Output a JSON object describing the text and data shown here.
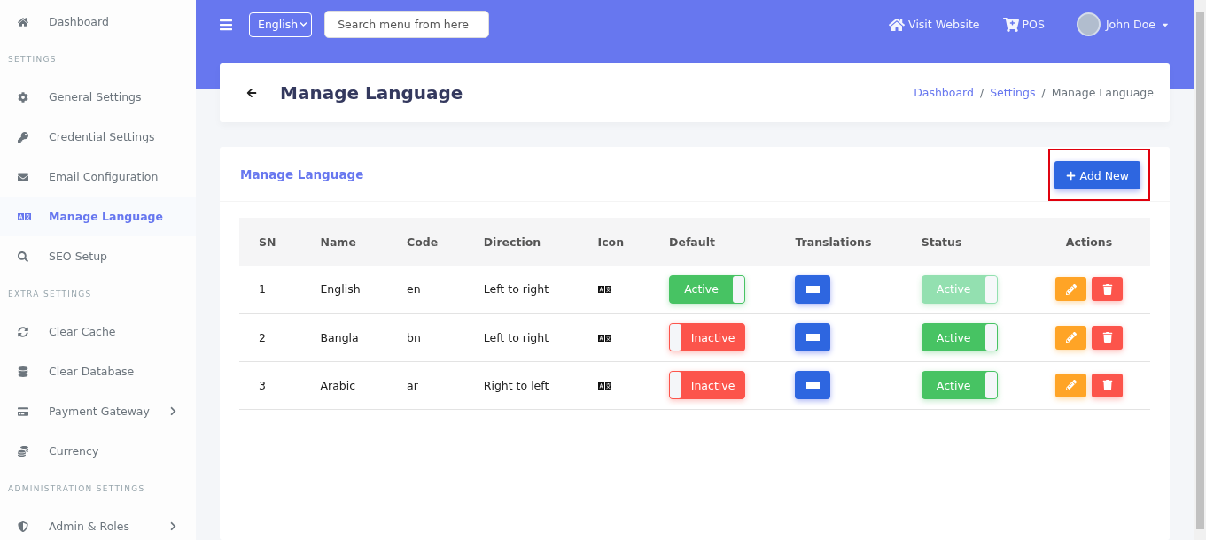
{
  "sidebar": {
    "items": [
      {
        "kind": "link",
        "label": "Dashboard",
        "selected": false,
        "has_submenu": false
      },
      {
        "kind": "heading",
        "label": "SETTINGS"
      },
      {
        "kind": "link",
        "label": "General Settings",
        "selected": false,
        "has_submenu": false
      },
      {
        "kind": "link",
        "label": "Credential Settings",
        "selected": false,
        "has_submenu": false
      },
      {
        "kind": "link",
        "label": "Email Configuration",
        "selected": false,
        "has_submenu": false
      },
      {
        "kind": "link",
        "label": "Manage Language",
        "selected": true,
        "has_submenu": false
      },
      {
        "kind": "link",
        "label": "SEO Setup",
        "selected": false,
        "has_submenu": false
      },
      {
        "kind": "heading",
        "label": "EXTRA SETTINGS"
      },
      {
        "kind": "link",
        "label": "Clear Cache",
        "selected": false,
        "has_submenu": false
      },
      {
        "kind": "link",
        "label": "Clear Database",
        "selected": false,
        "has_submenu": false
      },
      {
        "kind": "link",
        "label": "Payment Gateway",
        "selected": false,
        "has_submenu": true
      },
      {
        "kind": "link",
        "label": "Currency",
        "selected": false,
        "has_submenu": false
      },
      {
        "kind": "heading",
        "label": "ADMINISTRATION SETTINGS"
      },
      {
        "kind": "link",
        "label": "Admin & Roles",
        "selected": false,
        "has_submenu": true
      }
    ]
  },
  "topbar": {
    "language": "English",
    "search": {
      "placeholder": "Search menu from here"
    },
    "links": [
      "Visit Website",
      "POS"
    ],
    "user": "John Doe"
  },
  "page_header": {
    "title": "Manage Language",
    "separator": "/",
    "breadcrumbs": [
      {
        "label": "Dashboard",
        "current": false
      },
      {
        "label": "Settings",
        "current": false
      },
      {
        "label": "Manage Language",
        "current": true
      }
    ]
  },
  "card": {
    "title": "Manage Language",
    "add_button": {
      "label": "Add New",
      "highlighted": true
    },
    "table": {
      "columns": [
        "SN",
        "Name",
        "Code",
        "Direction",
        "Icon",
        "Default",
        "Translations",
        "Status",
        "Actions"
      ],
      "rows": [
        {
          "sn": "1",
          "name": "English",
          "code": "en",
          "direction": "Left to right",
          "default": {
            "label": "Active",
            "on": true,
            "disabled": false
          },
          "status": {
            "label": "Active",
            "on": true,
            "disabled": true
          }
        },
        {
          "sn": "2",
          "name": "Bangla",
          "code": "bn",
          "direction": "Left to right",
          "default": {
            "label": "Inactive",
            "on": false,
            "disabled": false
          },
          "status": {
            "label": "Active",
            "on": true,
            "disabled": false
          }
        },
        {
          "sn": "3",
          "name": "Arabic",
          "code": "ar",
          "direction": "Right to left",
          "default": {
            "label": "Inactive",
            "on": false,
            "disabled": false
          },
          "status": {
            "label": "Active",
            "on": true,
            "disabled": false
          }
        }
      ]
    }
  }
}
